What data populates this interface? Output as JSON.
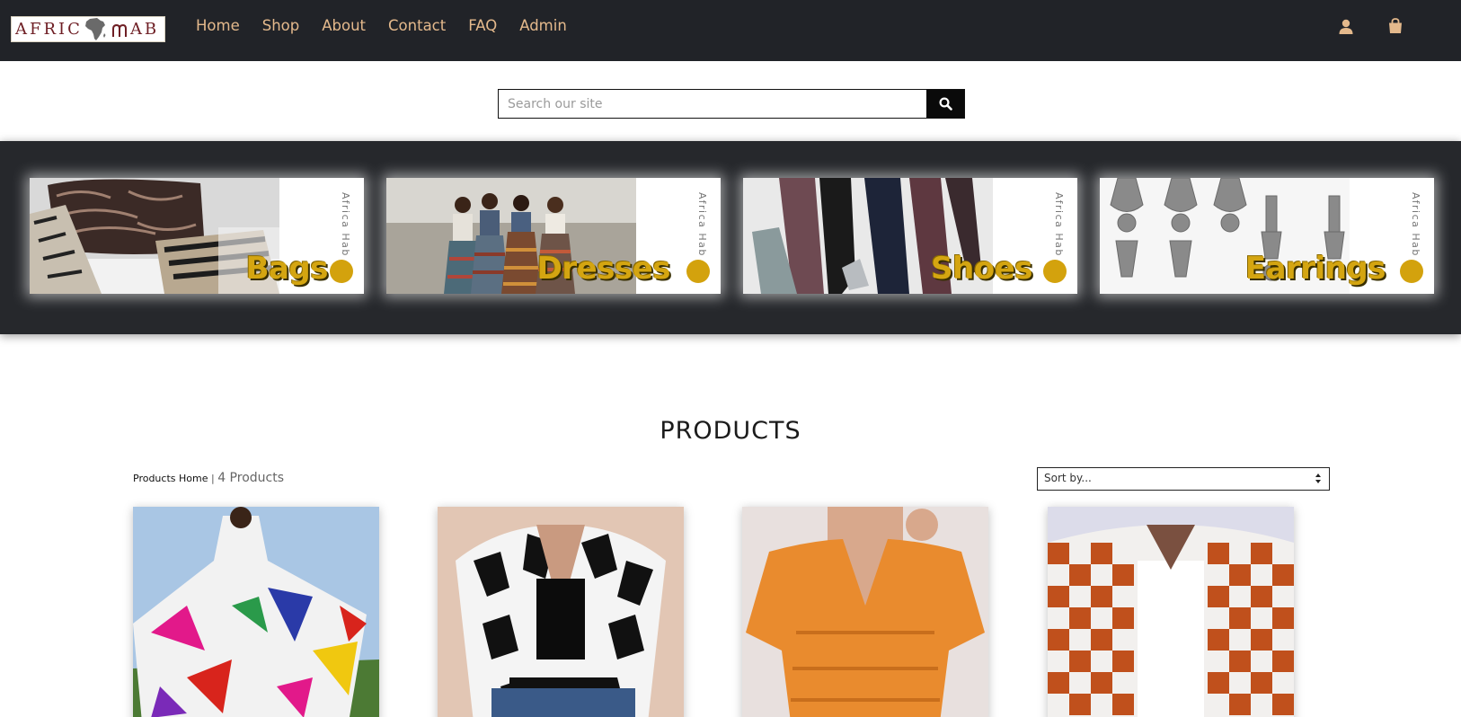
{
  "brand": {
    "logo_text_left": "AFRIC",
    "logo_text_right": "AB"
  },
  "nav": {
    "items": [
      "Home",
      "Shop",
      "About",
      "Contact",
      "FAQ",
      "Admin"
    ]
  },
  "header_icons": [
    "user-icon",
    "shopping-bag-icon"
  ],
  "search": {
    "placeholder": "Search our site",
    "icon": "search-icon"
  },
  "categories": [
    {
      "label": "Bags",
      "side_text": "Africa Hab"
    },
    {
      "label": "Dresses",
      "side_text": "Africa Hab"
    },
    {
      "label": "Shoes",
      "side_text": "Africa Hab"
    },
    {
      "label": "Earrings",
      "side_text": "Africa Hab"
    }
  ],
  "products": {
    "title": "PRODUCTS",
    "breadcrumb": "Products Home",
    "separator": "|",
    "count": "4 Products",
    "sort_placeholder": "Sort by..."
  },
  "colors": {
    "header_bg": "#212328",
    "nav_text": "#e4b98c",
    "band_bg": "#26282c",
    "category_label": "#d4a511",
    "logo_text": "#6e1e24"
  }
}
